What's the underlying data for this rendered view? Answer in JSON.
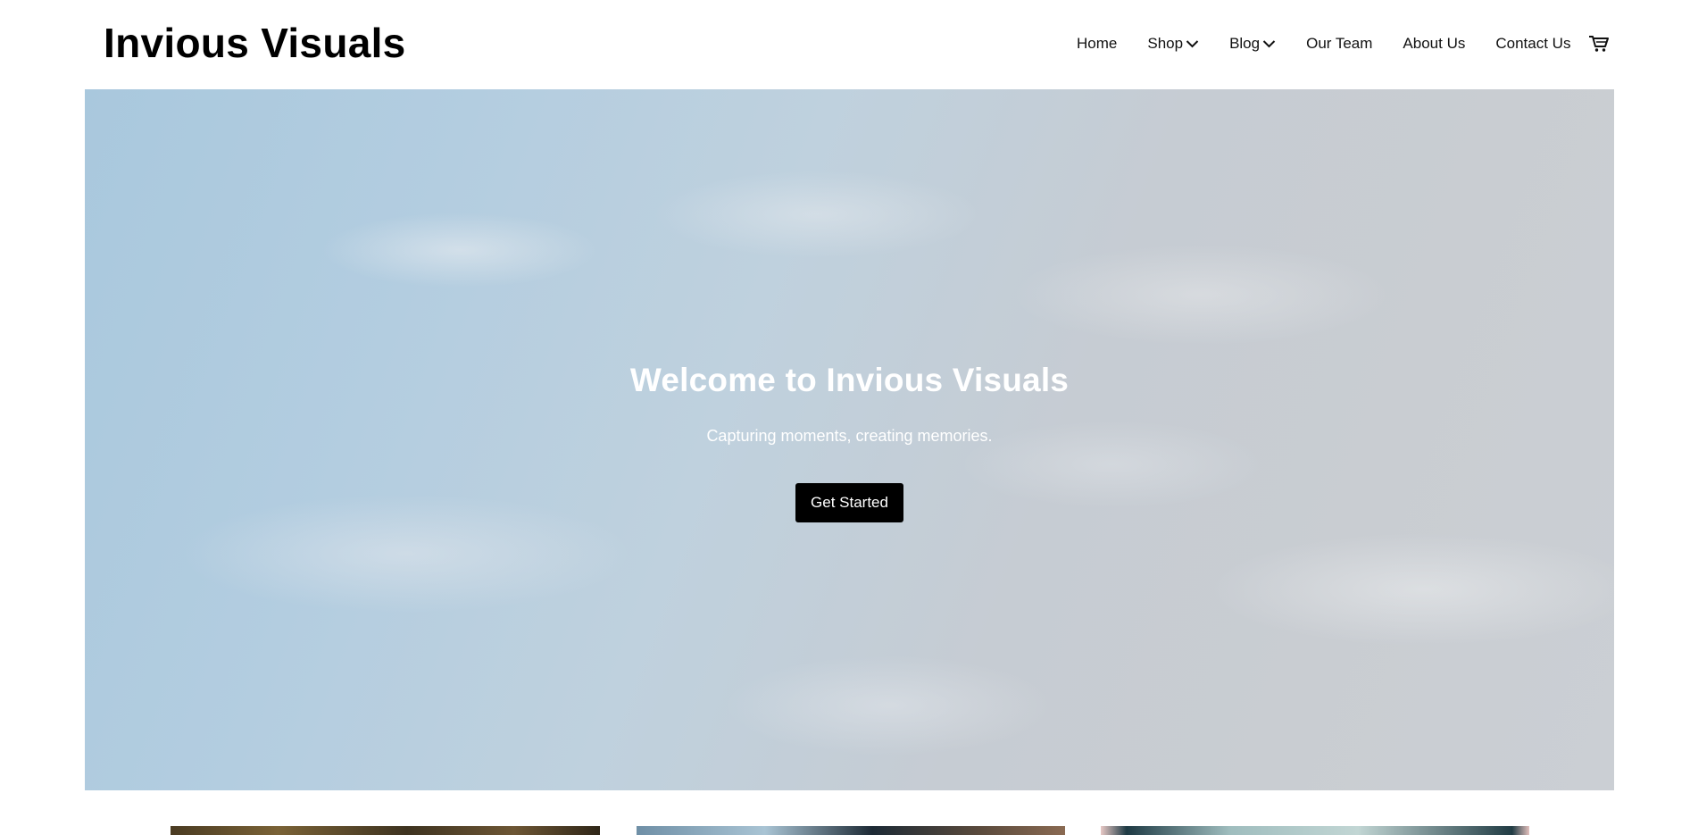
{
  "header": {
    "brand": "Invious Visuals",
    "nav": {
      "home": "Home",
      "shop": "Shop",
      "blog": "Blog",
      "our_team": "Our Team",
      "about_us": "About Us",
      "contact_us": "Contact Us"
    },
    "cart_icon": "shopping-cart-icon",
    "dropdown_icon": "chevron-down-icon"
  },
  "hero": {
    "title": "Welcome to Invious Visuals",
    "subtitle": "Capturing moments, creating memories.",
    "button_label": "Get Started"
  },
  "colors": {
    "text": "#111111",
    "hero_text": "#ffffff",
    "button_bg": "#000000",
    "button_text": "#ffffff",
    "hero_sky": "#b7cfe0"
  }
}
